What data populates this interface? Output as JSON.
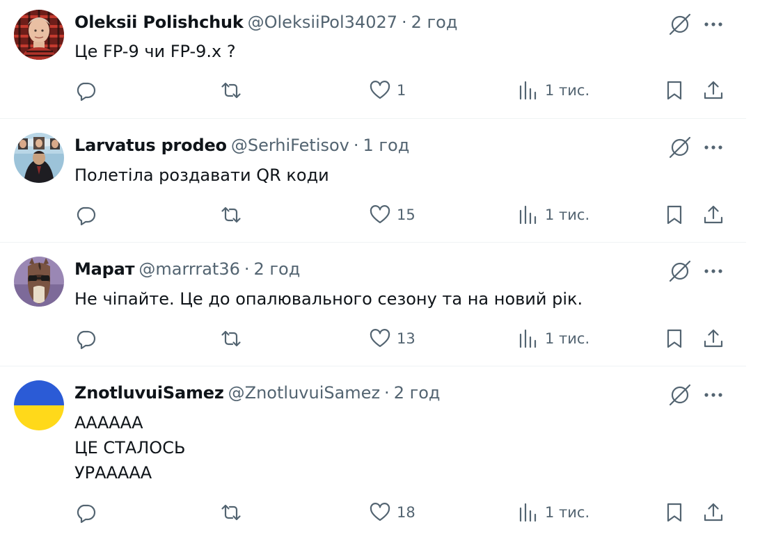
{
  "replies": [
    {
      "name": "Oleksii Polishchuk",
      "handle": "@OleksiiPol34027",
      "time": "2 год",
      "lines": [
        "Це FP-9 чи FP-9.x ?"
      ],
      "replies_count": "",
      "retweets_count": "",
      "likes": "1",
      "views": "1 тис.",
      "avatar": "photo of man in red plaid shirt"
    },
    {
      "name": "Larvatus prodeo",
      "handle": "@SerhiFetisov",
      "time": "1 год",
      "lines": [
        "Полетіла роздавати QR коди"
      ],
      "replies_count": "",
      "retweets_count": "",
      "likes": "15",
      "views": "1 тис.",
      "avatar": "surreal painting with man in suit and sky"
    },
    {
      "name": "Марат",
      "handle": "@marrrat36",
      "time": "2 год",
      "lines": [
        "Не чіпайте. Це до опалювального сезону та на новий рік."
      ],
      "replies_count": "",
      "retweets_count": "",
      "likes": "13",
      "views": "1 тис.",
      "avatar": "cartoon horse character"
    },
    {
      "name": "ZnotluvuiSamez",
      "handle": "@ZnotluvuiSamez",
      "time": "2 год",
      "lines": [
        "АААААА",
        "ЦЕ СТАЛОСЬ",
        "УРААААА"
      ],
      "replies_count": "",
      "retweets_count": "",
      "likes": "18",
      "views": "1 тис.",
      "avatar": "Ukrainian flag blue and yellow"
    }
  ],
  "icons": {
    "reply": "reply-icon",
    "retweet": "retweet-icon",
    "like": "heart-icon",
    "views": "views-icon",
    "bookmark": "bookmark-icon",
    "share": "share-icon",
    "grok": "grok-icon",
    "more": "more-icon"
  },
  "colors": {
    "text": "#0f1419",
    "secondary": "#536471",
    "divider": "#eff3f4",
    "flag_blue": "#2b5bd6",
    "flag_yellow": "#ffd91a"
  }
}
